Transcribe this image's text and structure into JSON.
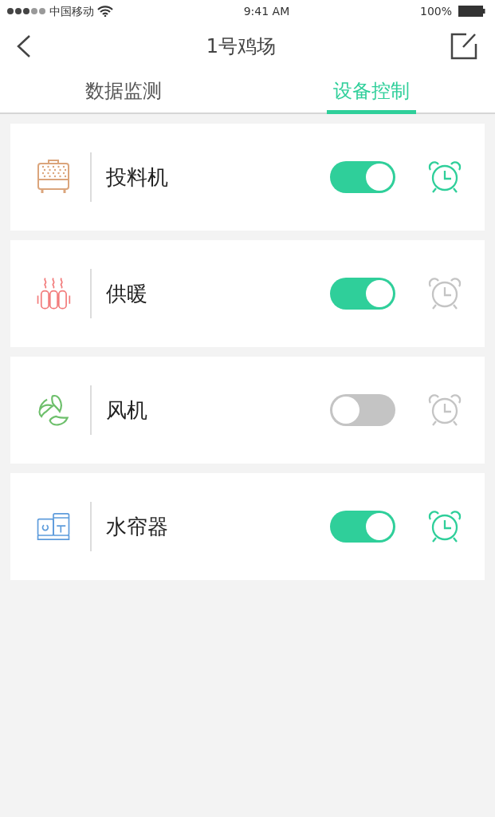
{
  "status_bar": {
    "carrier": "中国移动",
    "time": "9:41 AM",
    "battery": "100%"
  },
  "nav": {
    "title": "1号鸡场"
  },
  "tabs": [
    {
      "label": "数据监测",
      "selected": false
    },
    {
      "label": "设备控制",
      "selected": true
    }
  ],
  "devices": [
    {
      "kind": "feeder",
      "name": "投料机",
      "color": "#dba57c",
      "on": true,
      "timer_on": true
    },
    {
      "kind": "heater",
      "name": "供暖",
      "color": "#f27b7b",
      "on": true,
      "timer_on": false
    },
    {
      "kind": "fan",
      "name": "风机",
      "color": "#6dbf6b",
      "on": false,
      "timer_on": false
    },
    {
      "kind": "curtain",
      "name": "水帘器",
      "color": "#5e9cdc",
      "on": true,
      "timer_on": true
    }
  ]
}
